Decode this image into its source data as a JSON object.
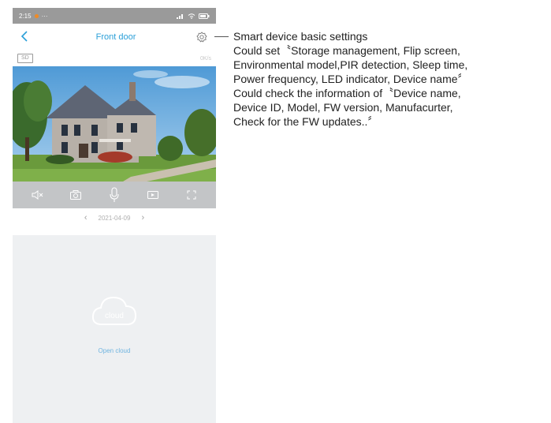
{
  "status_bar": {
    "time": "2:15",
    "dots": "···"
  },
  "nav": {
    "title": "Front door"
  },
  "sub_bar": {
    "sd_label": "SD",
    "stream_info": "0K/s"
  },
  "date_bar": {
    "date": "2021-04-09",
    "prev": "‹",
    "next": "›"
  },
  "cloud": {
    "icon_text": "cloud",
    "link": "Open cloud"
  },
  "annotation": {
    "lines": [
      "Smart device basic settings",
      "Could set〝Storage management, Flip screen,",
      "Environmental model,PIR detection, Sleep time,",
      "Power frequency, LED indicator, Device name〞",
      "Could check the information of〝Device name,",
      "Device ID, Model, FW version, Manufacurter,",
      "Check for the FW updates..〞"
    ]
  },
  "colors": {
    "accent": "#2a9fd8",
    "status_bg": "#9a9a9a",
    "controls_bg": "#c3c5c7",
    "cloud_bg": "#eef0f2"
  },
  "icons": {
    "back": "chevron-left-icon",
    "settings": "gear-icon",
    "mute": "speaker-mute-icon",
    "snapshot": "camera-icon",
    "talk": "microphone-icon",
    "record": "video-record-icon",
    "fullscreen": "fullscreen-icon"
  }
}
